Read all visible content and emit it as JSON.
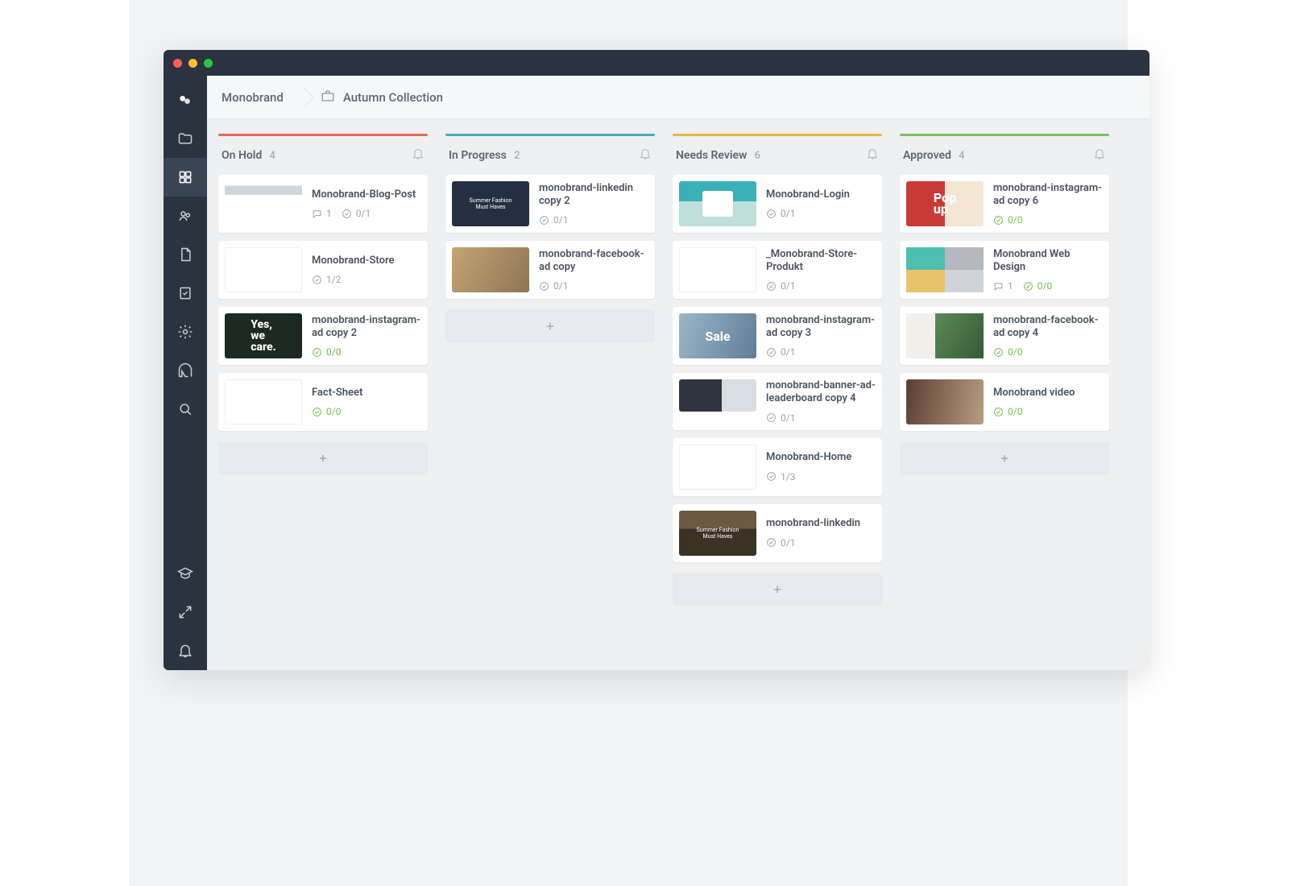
{
  "breadcrumb": {
    "workspace": "Monobrand",
    "project": "Autumn Collection"
  },
  "columns": [
    {
      "id": "on-hold",
      "title": "On Hold",
      "count": 4,
      "color": "#e26a5a",
      "cards": [
        {
          "title": "Monobrand-Blog-Post",
          "comments": 1,
          "approve": "0/1",
          "approve_green": false
        },
        {
          "title": "Monobrand-Store",
          "approve": "1/2",
          "approve_green": false
        },
        {
          "title": "monobrand-instagram-ad copy 2",
          "approve": "0/0",
          "approve_green": true
        },
        {
          "title": "Fact-Sheet",
          "approve": "0/0",
          "approve_green": true
        }
      ]
    },
    {
      "id": "in-progress",
      "title": "In Progress",
      "count": 2,
      "color": "#4aa8bf",
      "cards": [
        {
          "title": "monobrand-linkedin copy 2",
          "approve": "0/1",
          "approve_green": false
        },
        {
          "title": "monobrand-facebook-ad copy",
          "approve": "0/1",
          "approve_green": false
        }
      ]
    },
    {
      "id": "needs-review",
      "title": "Needs Review",
      "count": 6,
      "color": "#e9b74c",
      "cards": [
        {
          "title": "Monobrand-Login",
          "approve": "0/1",
          "approve_green": false
        },
        {
          "title": "_Monobrand-Store-Produkt",
          "approve": "0/1",
          "approve_green": false
        },
        {
          "title": "monobrand-instagram-ad copy 3",
          "approve": "0/1",
          "approve_green": false
        },
        {
          "title": "monobrand-banner-ad-leaderboard copy 4",
          "approve": "0/1",
          "approve_green": false,
          "wide": true
        },
        {
          "title": "Monobrand-Home",
          "approve": "1/3",
          "approve_green": false
        },
        {
          "title": "monobrand-linkedin",
          "approve": "0/1",
          "approve_green": false
        }
      ]
    },
    {
      "id": "approved",
      "title": "Approved",
      "count": 4,
      "color": "#79c05b",
      "cards": [
        {
          "title": "monobrand-instagram-ad copy 6",
          "approve": "0/0",
          "approve_green": true
        },
        {
          "title": "Monobrand Web Design",
          "comments": 1,
          "approve": "0/0",
          "approve_green": true
        },
        {
          "title": "monobrand-facebook-ad copy 4",
          "approve": "0/0",
          "approve_green": true
        },
        {
          "title": "Monobrand video",
          "approve": "0/0",
          "approve_green": true
        }
      ]
    }
  ],
  "thumbs": {
    "care": "Yes,\nwe\ncare.",
    "popup": "Pop\nup",
    "sale": "Sale",
    "linkedin": "Summer Fashion\nMust Haves"
  }
}
